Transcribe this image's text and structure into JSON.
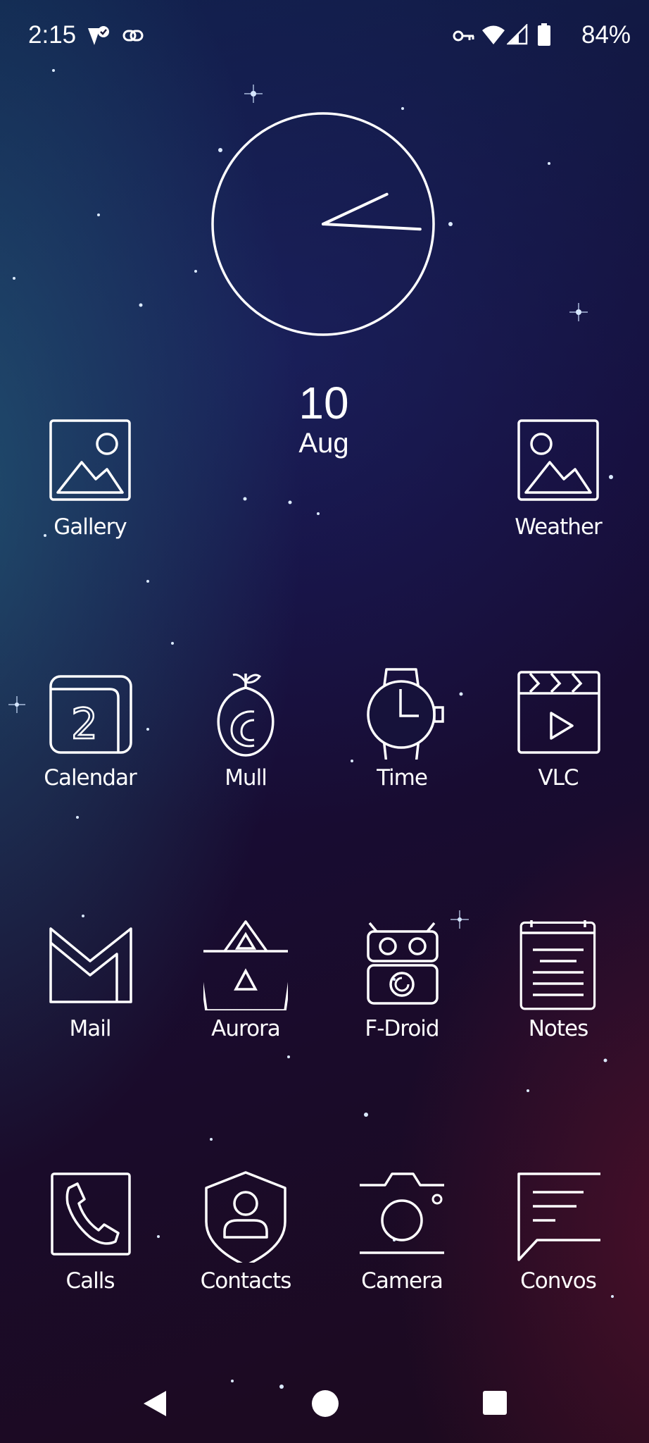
{
  "status_bar": {
    "time": "2:15",
    "battery_percent": "84%"
  },
  "clock_widget": {
    "hour_hand_deg": 65,
    "minute_hand_deg": 93,
    "date_day": "10",
    "date_month": "Aug"
  },
  "apps": [
    {
      "id": "gallery",
      "label": "Gallery",
      "icon": "image-icon"
    },
    {
      "id": "weather",
      "label": "Weather",
      "icon": "image-icon"
    },
    {
      "id": "calendar",
      "label": "Calendar",
      "icon": "calendar-icon"
    },
    {
      "id": "mull",
      "label": "Mull",
      "icon": "onion-icon"
    },
    {
      "id": "time",
      "label": "Time",
      "icon": "watch-icon"
    },
    {
      "id": "vlc",
      "label": "VLC",
      "icon": "clapperboard-icon"
    },
    {
      "id": "mail",
      "label": "Mail",
      "icon": "mail-icon"
    },
    {
      "id": "aurora",
      "label": "Aurora",
      "icon": "basket-icon"
    },
    {
      "id": "fdroid",
      "label": "F-Droid",
      "icon": "robot-icon"
    },
    {
      "id": "notes",
      "label": "Notes",
      "icon": "notepad-icon"
    },
    {
      "id": "calls",
      "label": "Calls",
      "icon": "phone-icon"
    },
    {
      "id": "contacts",
      "label": "Contacts",
      "icon": "shield-person-icon"
    },
    {
      "id": "camera",
      "label": "Camera",
      "icon": "camera-icon"
    },
    {
      "id": "convos",
      "label": "Convos",
      "icon": "chat-icon"
    }
  ],
  "colors": {
    "icon_stroke": "#ffffff",
    "text": "#ffffff"
  }
}
